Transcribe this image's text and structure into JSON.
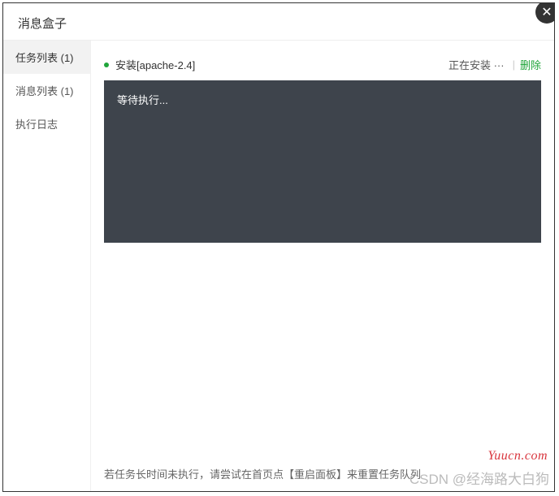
{
  "header": {
    "title": "消息盒子"
  },
  "close_icon": "✕",
  "sidebar": {
    "items": [
      {
        "label": "任务列表 (1)",
        "active": true
      },
      {
        "label": "消息列表 (1)",
        "active": false
      },
      {
        "label": "执行日志",
        "active": false
      }
    ]
  },
  "task": {
    "name": "安装[apache-2.4]",
    "status": "正在安装 ···",
    "divider": "|",
    "delete_label": "删除"
  },
  "console": {
    "text": "等待执行..."
  },
  "footer": {
    "tip": "若任务长时间未执行，请尝试在首页点【重启面板】来重置任务队列"
  },
  "watermark": {
    "site": "Yuucn.com",
    "author": "CSDN @经海路大白狗"
  }
}
